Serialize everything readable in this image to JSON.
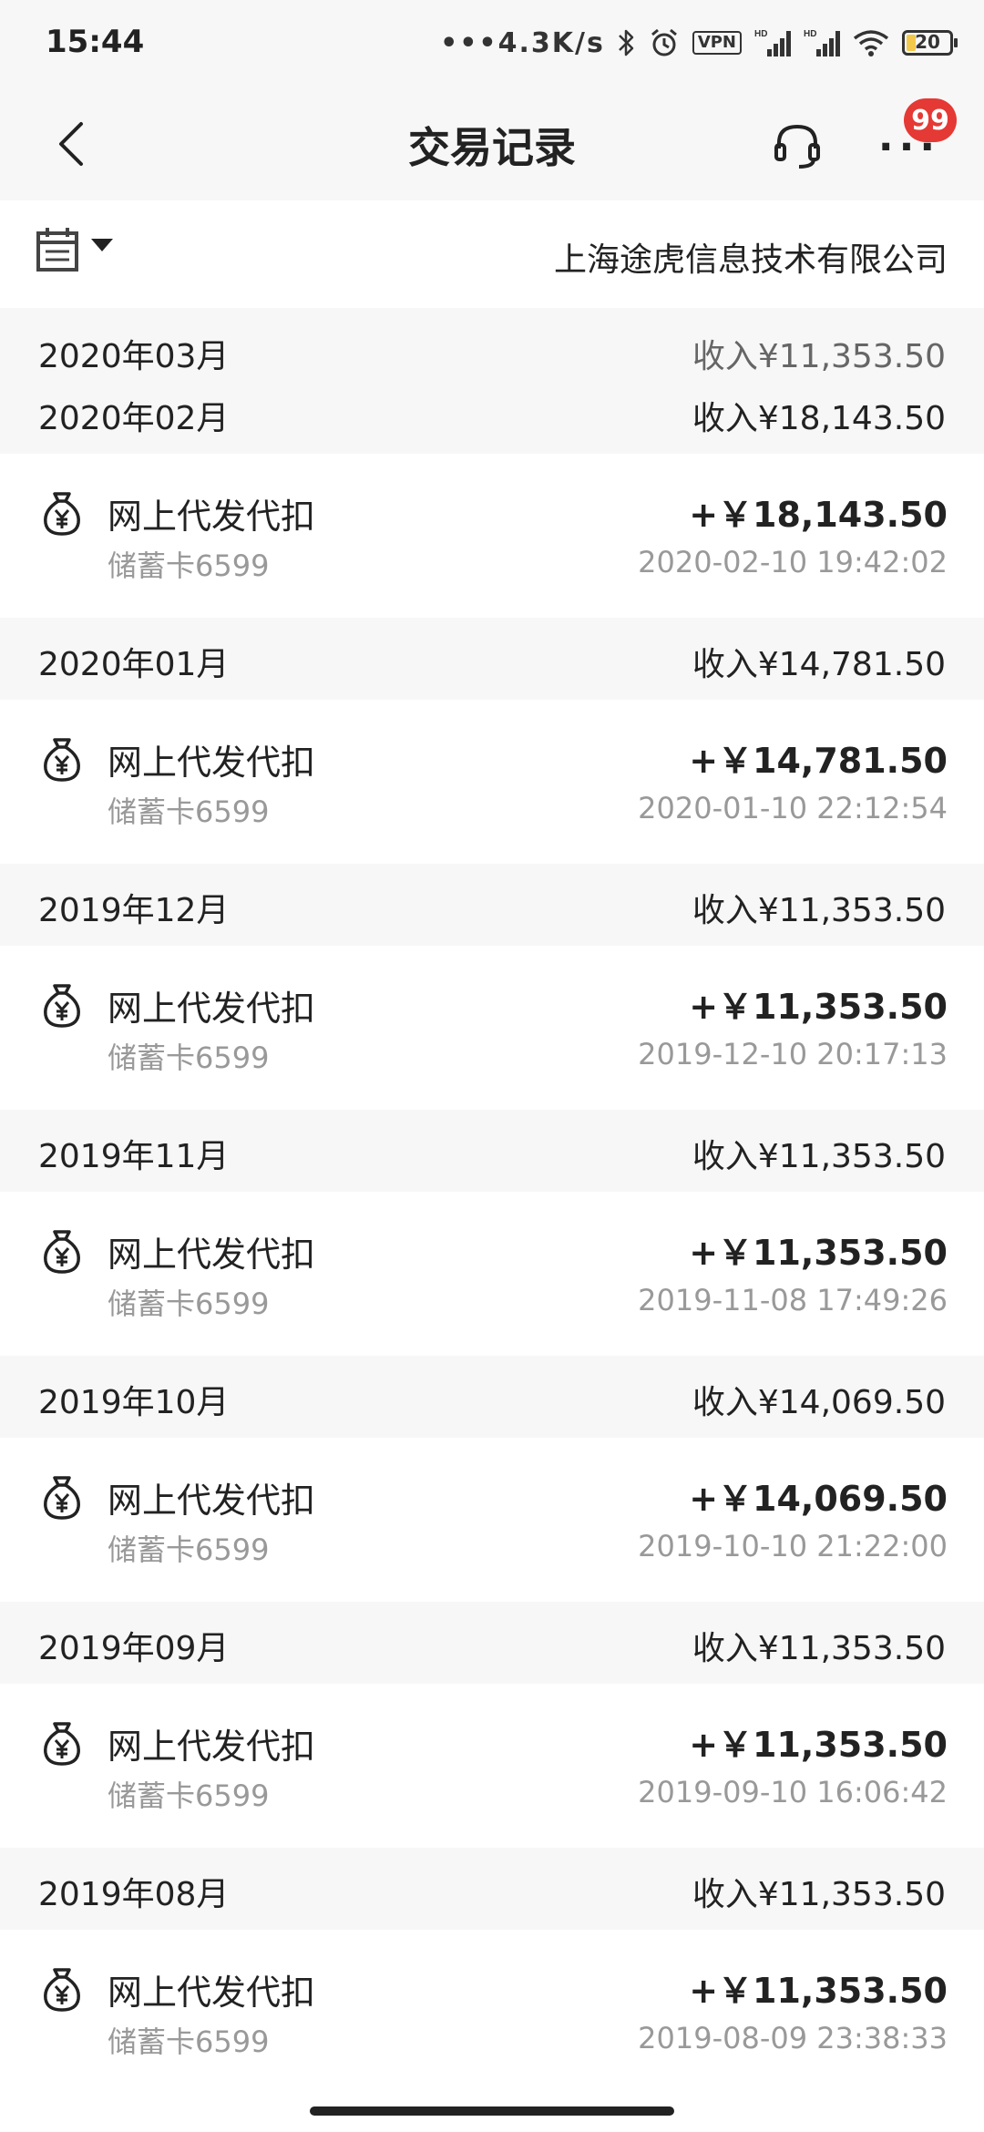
{
  "status_bar": {
    "time": "15:44",
    "network_speed": "•••4.3K/s",
    "vpn_label": "VPN",
    "battery_level": "20",
    "battery_fraction": 0.2,
    "icons": [
      "bluetooth-icon",
      "alarm-icon",
      "vpn-icon",
      "signal-icon",
      "signal-icon",
      "wifi-icon",
      "battery-icon"
    ]
  },
  "header": {
    "title": "交易记录",
    "badge_count": "99",
    "icons": [
      "back-icon",
      "headset-icon",
      "more-icon"
    ]
  },
  "filter": {
    "company": "上海途虎信息技术有限公司",
    "icons": [
      "calendar-icon",
      "caret-down-icon"
    ]
  },
  "months": [
    {
      "label": "2020年03月",
      "income": "收入¥11,353.50",
      "transactions": []
    },
    {
      "label": "2020年02月",
      "income": "收入¥18,143.50",
      "transactions": [
        {
          "title": "网上代发代扣",
          "card": "储蓄卡6599",
          "amount": "+￥18,143.50",
          "time": "2020-02-10 19:42:02"
        }
      ]
    },
    {
      "label": "2020年01月",
      "income": "收入¥14,781.50",
      "transactions": [
        {
          "title": "网上代发代扣",
          "card": "储蓄卡6599",
          "amount": "+￥14,781.50",
          "time": "2020-01-10 22:12:54"
        }
      ]
    },
    {
      "label": "2019年12月",
      "income": "收入¥11,353.50",
      "transactions": [
        {
          "title": "网上代发代扣",
          "card": "储蓄卡6599",
          "amount": "+￥11,353.50",
          "time": "2019-12-10 20:17:13"
        }
      ]
    },
    {
      "label": "2019年11月",
      "income": "收入¥11,353.50",
      "transactions": [
        {
          "title": "网上代发代扣",
          "card": "储蓄卡6599",
          "amount": "+￥11,353.50",
          "time": "2019-11-08 17:49:26"
        }
      ]
    },
    {
      "label": "2019年10月",
      "income": "收入¥14,069.50",
      "transactions": [
        {
          "title": "网上代发代扣",
          "card": "储蓄卡6599",
          "amount": "+￥14,069.50",
          "time": "2019-10-10 21:22:00"
        }
      ]
    },
    {
      "label": "2019年09月",
      "income": "收入¥11,353.50",
      "transactions": [
        {
          "title": "网上代发代扣",
          "card": "储蓄卡6599",
          "amount": "+￥11,353.50",
          "time": "2019-09-10 16:06:42"
        }
      ]
    },
    {
      "label": "2019年08月",
      "income": "收入¥11,353.50",
      "transactions": [
        {
          "title": "网上代发代扣",
          "card": "储蓄卡6599",
          "amount": "+￥11,353.50",
          "time": "2019-08-09 23:38:33"
        }
      ]
    }
  ]
}
